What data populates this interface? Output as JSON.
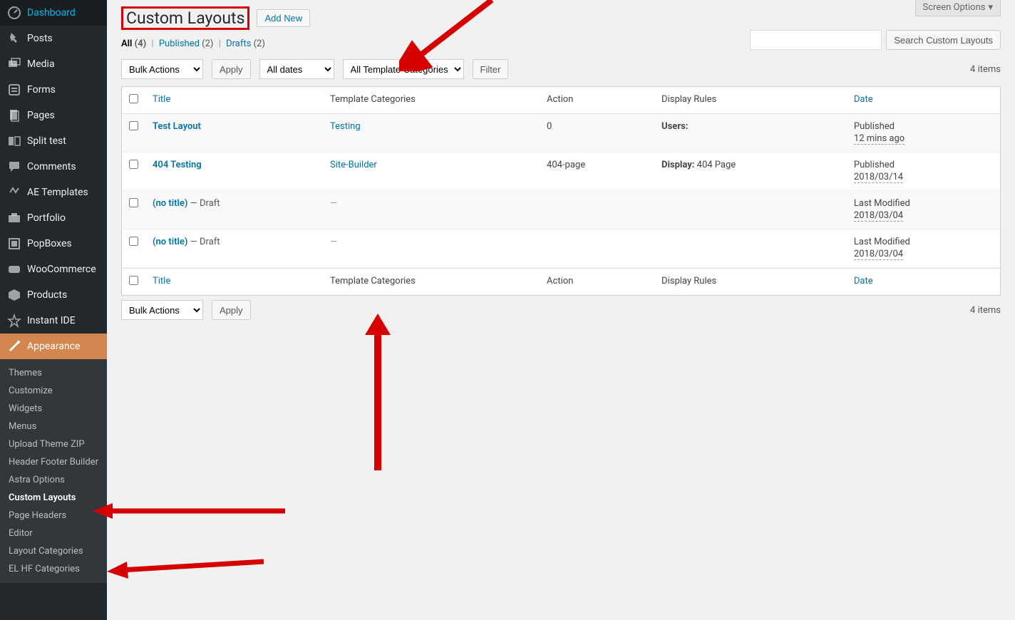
{
  "screen_options": "Screen Options",
  "sidebar": [
    {
      "icon": "dashboard",
      "label": "Dashboard"
    },
    {
      "icon": "pin",
      "label": "Posts"
    },
    {
      "icon": "media",
      "label": "Media"
    },
    {
      "icon": "forms",
      "label": "Forms"
    },
    {
      "icon": "pages",
      "label": "Pages"
    },
    {
      "icon": "split",
      "label": "Split test"
    },
    {
      "icon": "comments",
      "label": "Comments"
    },
    {
      "icon": "ae",
      "label": "AE Templates"
    },
    {
      "icon": "portfolio",
      "label": "Portfolio"
    },
    {
      "icon": "popboxes",
      "label": "PopBoxes"
    },
    {
      "icon": "woo",
      "label": "WooCommerce"
    },
    {
      "icon": "products",
      "label": "Products"
    },
    {
      "icon": "ide",
      "label": "Instant IDE"
    },
    {
      "icon": "appearance",
      "label": "Appearance",
      "active": true
    }
  ],
  "appearance_submenu": [
    "Themes",
    "Customize",
    "Widgets",
    "Menus",
    "Upload Theme ZIP",
    "Header Footer Builder",
    "Astra Options",
    "Custom Layouts",
    "Page Headers",
    "Editor",
    "Layout Categories",
    "EL HF Categories"
  ],
  "appearance_current": "Custom Layouts",
  "page_title": "Custom Layouts",
  "add_new": "Add New",
  "views": {
    "all": {
      "label": "All",
      "count": "(4)"
    },
    "published": {
      "label": "Published",
      "count": "(2)"
    },
    "drafts": {
      "label": "Drafts",
      "count": "(2)"
    }
  },
  "bulk_label": "Bulk Actions",
  "apply_label": "Apply",
  "dates_label": "All dates",
  "cat_filter_label": "All Template Categories",
  "filter_label": "Filter",
  "items_count": "4 items",
  "search_button": "Search Custom Layouts",
  "columns": {
    "title": "Title",
    "categories": "Template Categories",
    "action": "Action",
    "rules": "Display Rules",
    "date": "Date"
  },
  "rows": [
    {
      "title": "Test Layout",
      "title_suffix": "",
      "cat": "Testing",
      "cat_link": true,
      "action": "0",
      "rules_label": "Users:",
      "rules_value": "",
      "date_line1": "Published",
      "date_line2": "12 mins ago"
    },
    {
      "title": "404 Testing",
      "title_suffix": "",
      "cat": "Site-Builder",
      "cat_link": true,
      "action": "404-page",
      "rules_label": "Display:",
      "rules_value": " 404 Page",
      "date_line1": "Published",
      "date_line2": "2018/03/14"
    },
    {
      "title": "(no title)",
      "title_suffix": " — Draft",
      "cat": "—",
      "cat_link": false,
      "action": "",
      "rules_label": "",
      "rules_value": "",
      "date_line1": "Last Modified",
      "date_line2": "2018/03/04"
    },
    {
      "title": "(no title)",
      "title_suffix": " — Draft",
      "cat": "—",
      "cat_link": false,
      "action": "",
      "rules_label": "",
      "rules_value": "",
      "date_line1": "Last Modified",
      "date_line2": "2018/03/04"
    }
  ]
}
